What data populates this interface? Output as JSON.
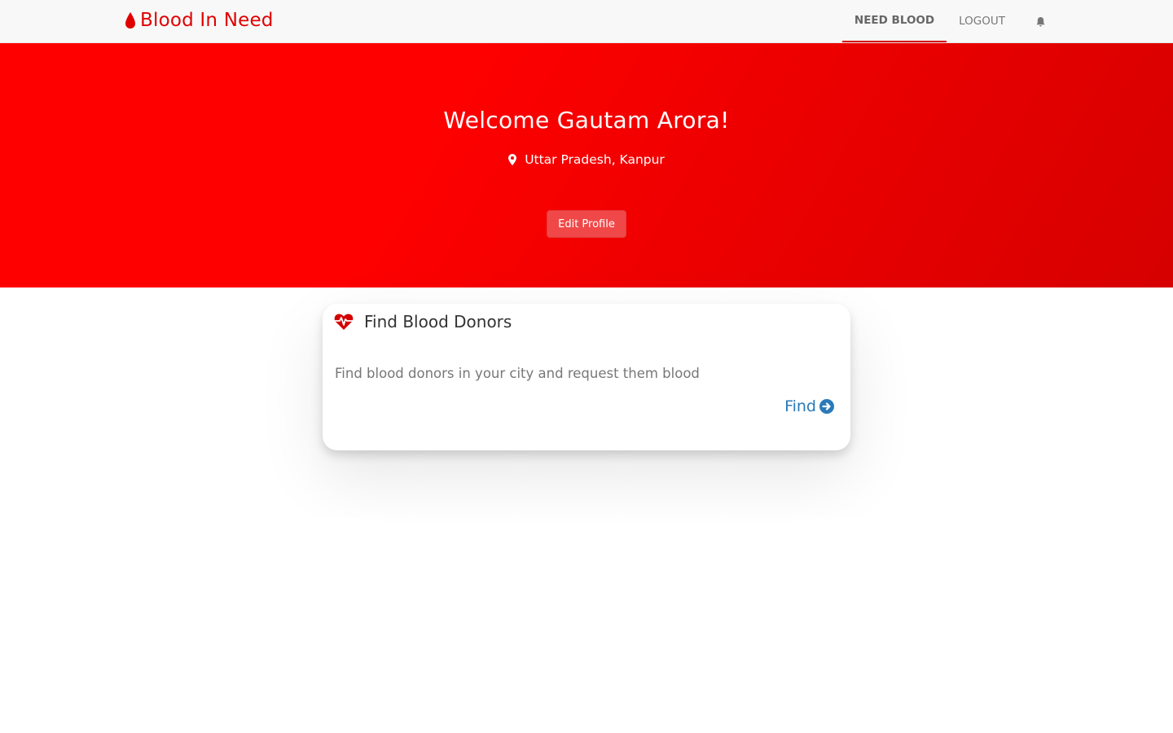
{
  "navbar": {
    "brand": "Blood In Need",
    "brand_icon": "blood-drop-icon",
    "links": [
      {
        "label": "NEED BLOOD",
        "active": true
      },
      {
        "label": "LOGOUT",
        "active": false
      }
    ],
    "bell_icon": "bell-icon"
  },
  "hero": {
    "welcome": "Welcome Gautam Arora!",
    "location_icon": "map-marker-icon",
    "location": "Uttar Pradesh, Kanpur",
    "edit_button": "Edit Profile"
  },
  "card": {
    "icon": "heartbeat-icon",
    "title": "Find Blood Donors",
    "description": "Find blood donors in your city and request them blood",
    "action_label": "Find",
    "action_icon": "arrow-circle-right-icon"
  },
  "colors": {
    "brand": "#e10000",
    "hero_bg": "#ff0000",
    "button_bg": "#f04848",
    "link": "#2a7ab9",
    "active_underline": "#d40000"
  }
}
